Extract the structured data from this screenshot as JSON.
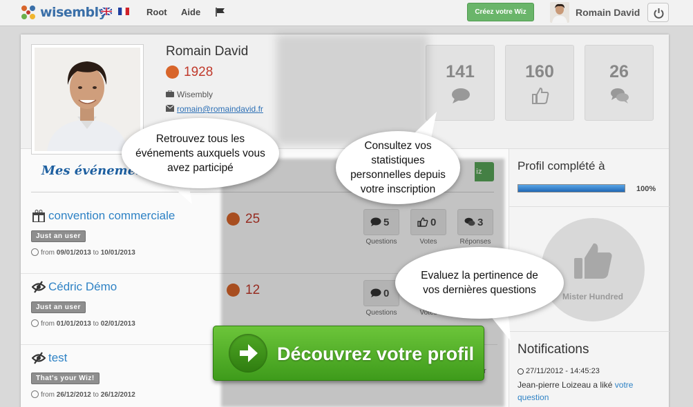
{
  "topbar": {
    "logo_text": "wisembly",
    "nav_links": [
      "Root",
      "Aide"
    ],
    "create_button": "Créez votre Wiz",
    "username": "Romain David"
  },
  "profile": {
    "name": "Romain David",
    "points": "1928",
    "company": "Wisembly",
    "email": "romain@romaindavid.fr",
    "stats": [
      {
        "value": "141",
        "icon": "speech-bubble-icon"
      },
      {
        "value": "160",
        "icon": "thumbs-up-icon"
      },
      {
        "value": "26",
        "icon": "replies-icon"
      }
    ]
  },
  "events": {
    "title": "Mes événements",
    "from_label": "from",
    "to_label": "to",
    "labels": {
      "questions": "Questions",
      "votes": "Votes",
      "replies": "Réponses"
    },
    "items": [
      {
        "name": "convention commerciale",
        "role": "Just an user",
        "start": "09/01/2013",
        "end": "10/01/2013",
        "points": "25",
        "questions": "5",
        "votes": "0",
        "replies": "3",
        "icon": "gift-icon"
      },
      {
        "name": "Cédric Démo",
        "role": "Just an user",
        "start": "01/01/2013",
        "end": "02/01/2013",
        "points": "12",
        "questions": "0",
        "icon": "hidden-eye-icon"
      },
      {
        "name": "test",
        "role": "That's your Wiz!",
        "start": "26/12/2012",
        "end": "26/12/2012",
        "icon": "hidden-eye-icon"
      }
    ]
  },
  "sidebar": {
    "profile_complete_title": "Profil complété à",
    "progress": 1.0,
    "progress_label": "100%",
    "badge_label": "Mister Hundred",
    "notifications_title": "Notifications",
    "notification": {
      "time": "27/11/2012 - 14:45:23",
      "text": "Jean-pierre Loizeau a liké",
      "link": "votre question"
    }
  },
  "bubbles": {
    "events": "Retrouvez tous les événements auxquels vous avez participé",
    "stats": "Consultez vos statistiques personnelles depuis votre inscription",
    "questions": "Evaluez la pertinence de vos dernières questions"
  },
  "partial_texts": {
    "wiz_button": "iz",
    "replies_partial": "er"
  },
  "cta": {
    "label": "Découvrez votre profil"
  },
  "colors": {
    "brand_blue": "#3a6fa8",
    "points_red": "#c0392b",
    "cta_green": "#52b02a"
  }
}
